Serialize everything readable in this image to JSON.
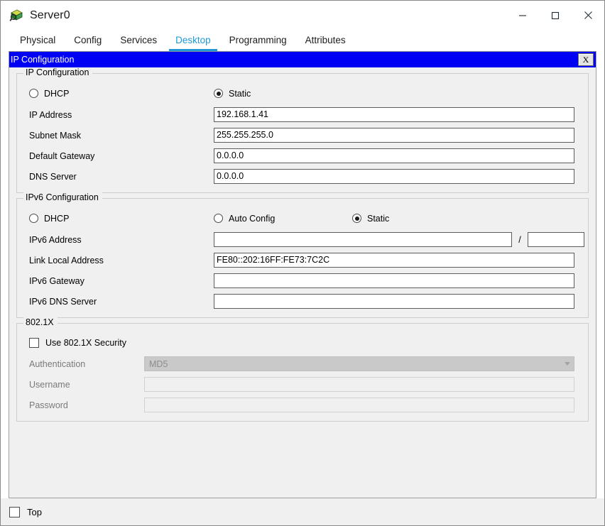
{
  "window": {
    "title": "Server0",
    "icon": "server-device-icon",
    "controls": {
      "minimize": "minimize-icon",
      "maximize": "maximize-icon",
      "close": "close-icon"
    }
  },
  "tabs": [
    {
      "label": "Physical",
      "active": false
    },
    {
      "label": "Config",
      "active": false
    },
    {
      "label": "Services",
      "active": false
    },
    {
      "label": "Desktop",
      "active": true
    },
    {
      "label": "Programming",
      "active": false
    },
    {
      "label": "Attributes",
      "active": false
    }
  ],
  "dialog": {
    "title": "IP Configuration",
    "close_label": "X"
  },
  "ipv4": {
    "legend": "IP Configuration",
    "mode": {
      "dhcp_label": "DHCP",
      "dhcp_selected": false,
      "static_label": "Static",
      "static_selected": true
    },
    "fields": [
      {
        "label": "IP Address",
        "value": "192.168.1.41"
      },
      {
        "label": "Subnet Mask",
        "value": "255.255.255.0"
      },
      {
        "label": "Default Gateway",
        "value": "0.0.0.0"
      },
      {
        "label": "DNS Server",
        "value": "0.0.0.0"
      }
    ]
  },
  "ipv6": {
    "legend": "IPv6 Configuration",
    "mode": {
      "dhcp_label": "DHCP",
      "dhcp_selected": false,
      "autoconfig_label": "Auto Config",
      "autoconfig_selected": false,
      "static_label": "Static",
      "static_selected": true
    },
    "address_label": "IPv6 Address",
    "address_value": "",
    "prefix_separator": "/",
    "prefix_value": "",
    "fields": [
      {
        "label": "Link Local Address",
        "value": "FE80::202:16FF:FE73:7C2C"
      },
      {
        "label": "IPv6 Gateway",
        "value": ""
      },
      {
        "label": "IPv6 DNS Server",
        "value": ""
      }
    ]
  },
  "dot1x": {
    "legend": "802.1X",
    "use_security_label": "Use 802.1X Security",
    "use_security_checked": false,
    "authentication_label": "Authentication",
    "authentication_value": "MD5",
    "username_label": "Username",
    "username_value": "",
    "password_label": "Password",
    "password_value": ""
  },
  "footer": {
    "top_label": "Top",
    "top_checked": false
  },
  "colors": {
    "accent_tab": "#1f9ad6",
    "dialog_titlebar": "#0000f5",
    "panel_bg": "#f0f0f0",
    "field_border": "#5c5c5c",
    "disabled_text": "#9a9a9a"
  }
}
